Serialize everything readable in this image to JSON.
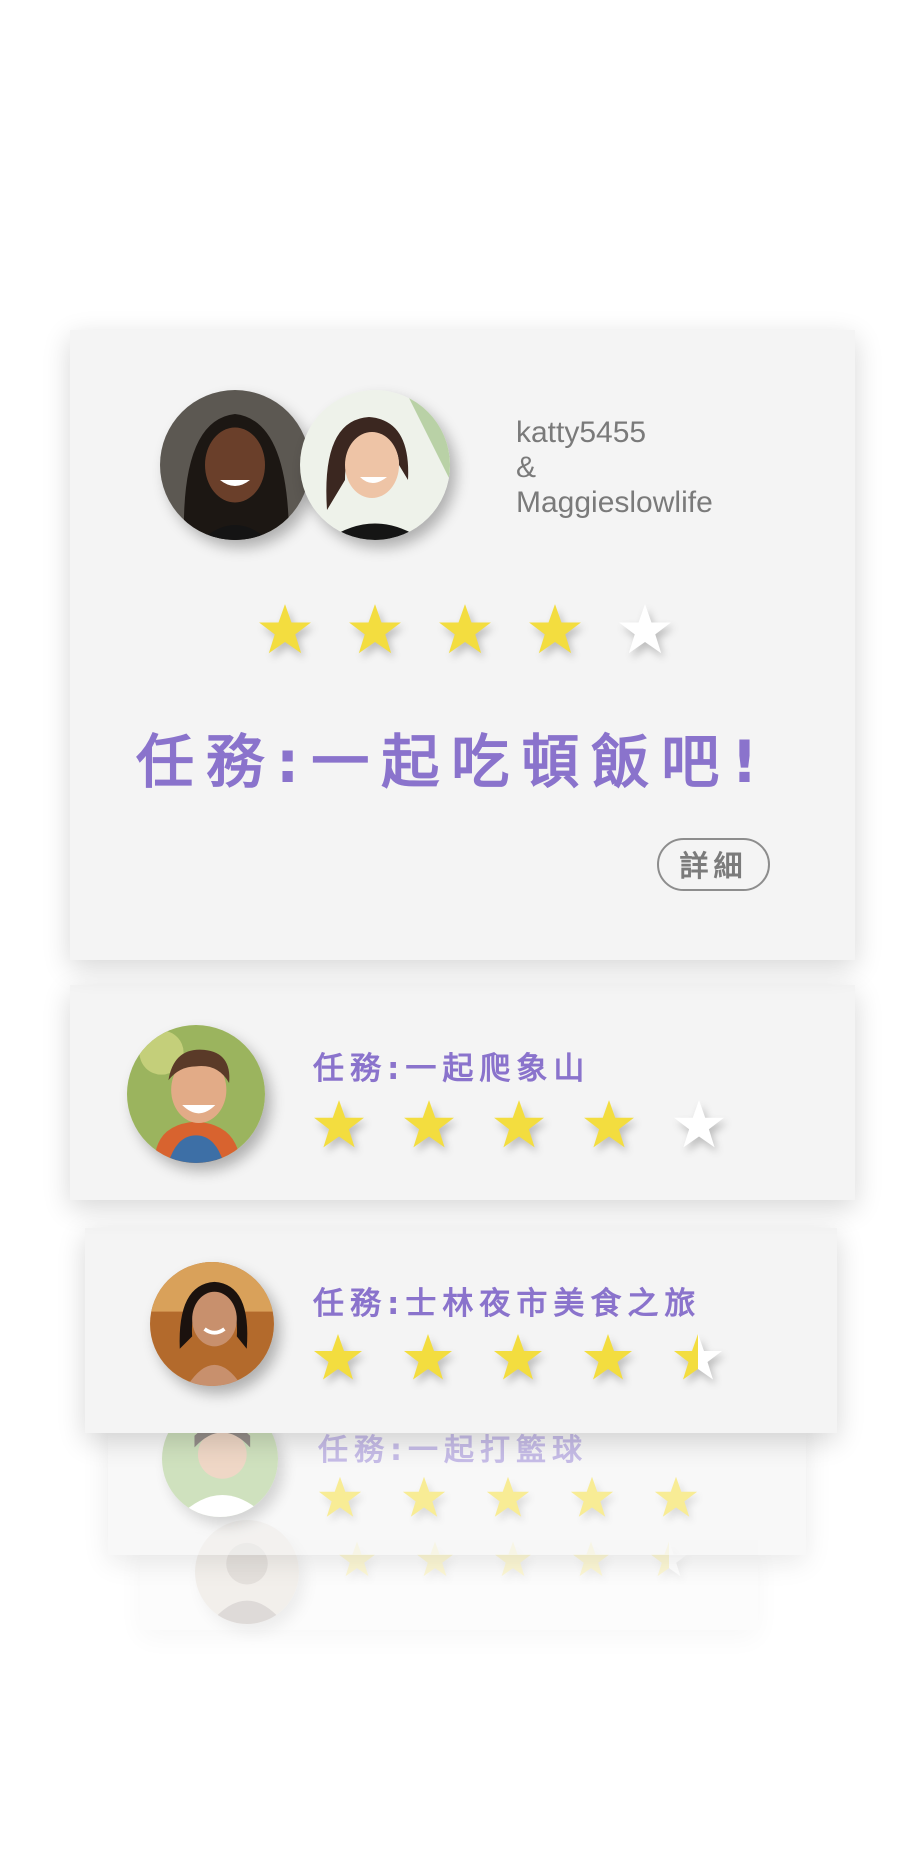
{
  "colors": {
    "accent": "#8a73cc",
    "star_filled": "#f3dd3f",
    "star_empty": "#ffffff",
    "card_bg": "#f4f4f4",
    "text_gray": "#7a7a7a"
  },
  "featured": {
    "user1": "katty5455",
    "ampersand": "&",
    "user2": "Maggieslowlife",
    "rating": 4,
    "title": "任務:一起吃頓飯吧!",
    "detail_label": "詳細"
  },
  "missions": [
    {
      "title": "任務:一起爬象山",
      "rating": 4
    },
    {
      "title": "任務:士林夜市美食之旅",
      "rating": 4.5
    },
    {
      "title": "任務:一起打籃球",
      "rating": 5
    },
    {
      "title": "",
      "rating": 4.5
    }
  ],
  "icons": {
    "star": "star-icon",
    "avatar": "avatar-photo"
  }
}
